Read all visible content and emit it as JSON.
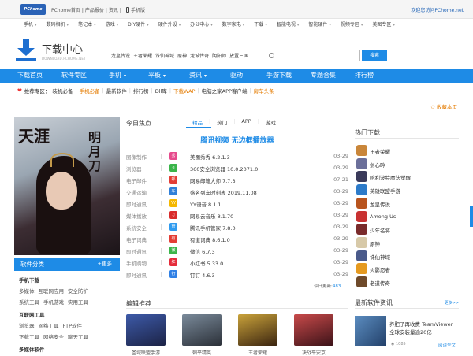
{
  "topbar": {
    "logo_text": "PChome",
    "links": [
      "PChome首页",
      "|",
      "产品报价",
      "|",
      "资讯",
      "|"
    ],
    "mobile_label": "手机版",
    "welcome": "欢迎您访问PChome.net"
  },
  "categories": [
    "手机",
    "数码相机",
    "笔记本",
    "游戏",
    "DIY硬件",
    "硬件外设",
    "办公中心",
    "数字家电",
    "下载",
    "智能电视",
    "智能硬件",
    "视频专区",
    "美图专区"
  ],
  "header": {
    "title": "下载中心",
    "subtitle": "DOWNLOAD.PCHOME.NET",
    "hot_keywords": [
      "龙皇传说",
      "王者荣耀",
      "诛仙神域",
      "原神",
      "龙城传奇",
      "阴阳师",
      "放置三国"
    ],
    "search_placeholder": "",
    "search_button": "搜索"
  },
  "main_nav": [
    {
      "label": "下载首页",
      "dropdown": false
    },
    {
      "label": "软件专区",
      "dropdown": false
    },
    {
      "label": "手机",
      "dropdown": true
    },
    {
      "label": "平板",
      "dropdown": true
    },
    {
      "label": "资讯",
      "dropdown": true
    },
    {
      "label": "驱动",
      "dropdown": false
    },
    {
      "label": "手游下载",
      "dropdown": false
    },
    {
      "label": "专题合集",
      "dropdown": false
    },
    {
      "label": "排行榜",
      "dropdown": false
    }
  ],
  "recommend": {
    "label": "推荐专区：",
    "items": [
      {
        "text": "装机必备",
        "highlight": false
      },
      {
        "text": "手机必备",
        "highlight": true
      },
      {
        "text": "最新软件",
        "highlight": false
      },
      {
        "text": "排行榜",
        "highlight": false
      },
      {
        "text": "Dll库",
        "highlight": false
      },
      {
        "text": "下载WAP",
        "highlight": true
      },
      {
        "text": "电脑之家APP客户端",
        "highlight": false
      },
      {
        "text": "房车头条",
        "highlight": true
      }
    ],
    "favorite": "收藏本页"
  },
  "hero": {
    "calligraphy_left": "天涯",
    "calligraphy_right": "明月刀"
  },
  "software_categories": {
    "title": "软件分类",
    "more": "+更多",
    "groups": [
      {
        "title": "手机下载",
        "rows": [
          [
            "多媒体",
            "互联网应用",
            "安全防护"
          ],
          [
            "系统工具",
            "手机游戏",
            "实用工具"
          ]
        ]
      },
      {
        "title": "互联网工具",
        "rows": [
          [
            "浏览器",
            "网络工具",
            "FTP软件"
          ],
          [
            "下载工具",
            "网络安全",
            "聊天工具"
          ]
        ]
      },
      {
        "title": "多媒体软件",
        "rows": []
      }
    ]
  },
  "focus": {
    "title": "今日焦点",
    "tabs": [
      {
        "label": "精品",
        "selected": true
      },
      {
        "label": "热门",
        "selected": false
      },
      {
        "label": "APP",
        "selected": false
      },
      {
        "label": "游戏",
        "selected": false
      }
    ],
    "headline": "腾讯视频 无边框播放器",
    "items": [
      {
        "category": "图像制作",
        "name": "美图秀秀 6.2.1.3",
        "date": "03-29",
        "color": "#e64a8c",
        "icon": "秀"
      },
      {
        "category": "浏览器",
        "name": "360安全浏览器 10.0.2071.0",
        "date": "03-29",
        "color": "#3ab54a",
        "icon": "e"
      },
      {
        "category": "电子邮件",
        "name": "网易邮箱大师 7.7.3",
        "date": "07-21",
        "color": "#e33d35",
        "icon": "邮"
      },
      {
        "category": "交通运输",
        "name": "盛名列车时刻表 2019.11.08",
        "date": "03-29",
        "color": "#2f7fd8",
        "icon": "车"
      },
      {
        "category": "即时通讯",
        "name": "YY语音 8.1.1",
        "date": "03-29",
        "color": "#f5b800",
        "icon": "YY"
      },
      {
        "category": "媒体播放",
        "name": "网易云音乐 8.1.70",
        "date": "03-29",
        "color": "#d92c2c",
        "icon": "♫"
      },
      {
        "category": "系统安全",
        "name": "腾讯手机管家 7.8.0",
        "date": "03-29",
        "color": "#2f9bef",
        "icon": "管"
      },
      {
        "category": "电子词典",
        "name": "有道词典 8.6.1.0",
        "date": "03-29",
        "color": "#e33d35",
        "icon": "有"
      },
      {
        "category": "即时通讯",
        "name": "微信 6.7.3",
        "date": "03-29",
        "color": "#3bb54a",
        "icon": "微"
      },
      {
        "category": "手机购物",
        "name": "小红书 5.33.0",
        "date": "03-29",
        "color": "#e52b3a",
        "icon": "红"
      },
      {
        "category": "即时通讯",
        "name": "钉钉 4.6.3",
        "date": "03-29",
        "color": "#2f80e5",
        "icon": "钉"
      }
    ],
    "today_label": "今日更新:",
    "today_count": "483"
  },
  "editor_pick": {
    "title": "编辑推荐",
    "games": [
      {
        "name": "圣域联盟手游",
        "color_a": "#3d5aa8",
        "color_b": "#1c2346"
      },
      {
        "name": "刺平精英",
        "color_a": "#7a8a9a",
        "color_b": "#2b3038"
      },
      {
        "name": "王者荣耀",
        "color_a": "#c9a23a",
        "color_b": "#3a2410"
      },
      {
        "name": "决战平安京",
        "color_a": "#c84a4a",
        "color_b": "#3b1218"
      }
    ]
  },
  "hot_downloads": {
    "title": "热门下载",
    "items": [
      {
        "name": "王者荣耀",
        "color": "#c9863a"
      },
      {
        "name": "剑心吟",
        "color": "#6b6f9a"
      },
      {
        "name": "哈利波特魔法觉醒",
        "color": "#3a3a5a"
      },
      {
        "name": "英雄联盟手游",
        "color": "#2d7bc9"
      },
      {
        "name": "龙皇传说",
        "color": "#b8541e"
      },
      {
        "name": "Among Us",
        "color": "#c83232"
      },
      {
        "name": "少年名将",
        "color": "#7a2b2b"
      },
      {
        "name": "原神",
        "color": "#d7c9a8"
      },
      {
        "name": "诛仙神域",
        "color": "#4a5a8a"
      },
      {
        "name": "火影忍者",
        "color": "#e59a20"
      },
      {
        "name": "老道传奇",
        "color": "#6e4a2a"
      }
    ]
  },
  "news": {
    "title": "最新软件资讯",
    "more": "更多>>",
    "item_text": "养肥了再收费 TeamViewer全球安装量逾20亿",
    "views": "1085",
    "read_more": "阅读全文"
  }
}
